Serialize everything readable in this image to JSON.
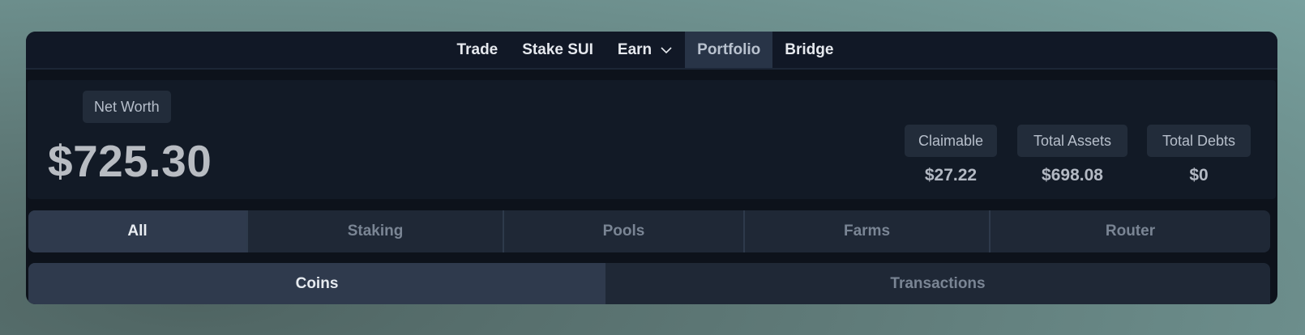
{
  "nav": {
    "items": [
      {
        "label": "Trade"
      },
      {
        "label": "Stake SUI"
      },
      {
        "label": "Earn"
      },
      {
        "label": "Portfolio"
      },
      {
        "label": "Bridge"
      }
    ],
    "active": "Portfolio"
  },
  "summary": {
    "net_worth_label": "Net Worth",
    "net_worth_value": "$725.30",
    "claimable_label": "Claimable",
    "claimable_value": "$27.22",
    "total_assets_label": "Total Assets",
    "total_assets_value": "$698.08",
    "total_debts_label": "Total Debts",
    "total_debts_value": "$0"
  },
  "filter_tabs": [
    "All",
    "Staking",
    "Pools",
    "Farms",
    "Router"
  ],
  "filter_active": "All",
  "view_tabs": [
    "Coins",
    "Transactions"
  ],
  "view_active": "Coins",
  "colors": {
    "window_bg": "#0d121b",
    "panel_bg": "#121a26",
    "active_tab_bg": "#2f3a4d",
    "inactive_text": "#7a8594"
  }
}
